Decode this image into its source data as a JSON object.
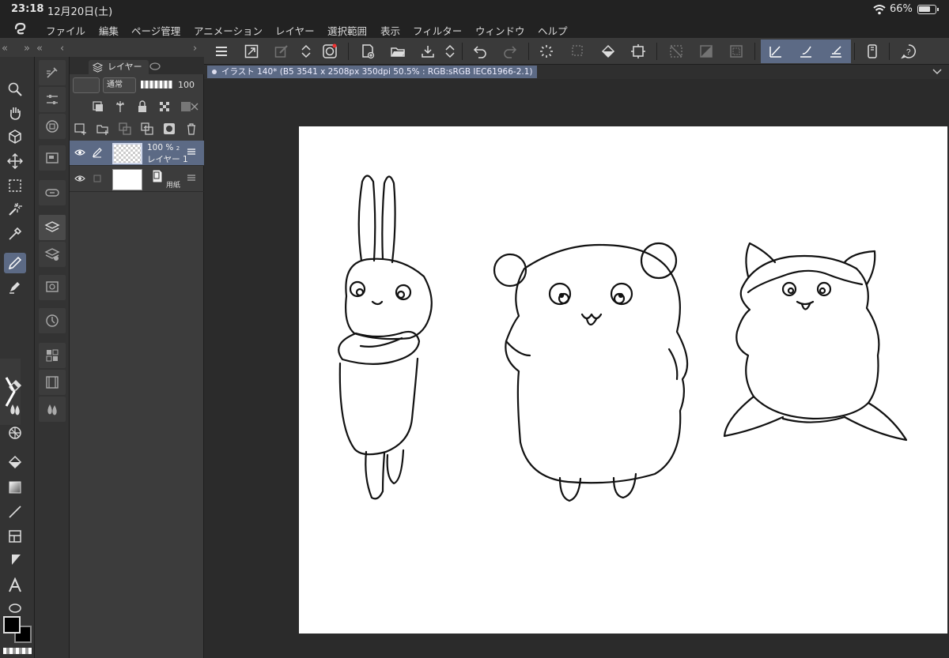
{
  "status": {
    "time": "23:18",
    "date": "12月20日(土)",
    "battery": "66%"
  },
  "menu": [
    "ファイル",
    "編集",
    "ページ管理",
    "アニメーション",
    "レイヤー",
    "選択範囲",
    "表示",
    "フィルター",
    "ウィンドウ",
    "ヘルプ"
  ],
  "layers": {
    "tab_label": "レイヤー",
    "blend_mode": "通常",
    "opacity": "100",
    "items": [
      {
        "opacity": "100 %",
        "name": "レイヤー 1",
        "extra": "2"
      },
      {
        "paper_label": "用紙"
      }
    ]
  },
  "document": {
    "title": "イラスト 140* (B5 3541 x 2508px 350dpi 50.5% : RGB:sRGB IEC61966-2.1)"
  },
  "colors": {
    "accent": "#5c6a85",
    "canvas": "#ffffff",
    "workspace": "#2b2b2b"
  }
}
